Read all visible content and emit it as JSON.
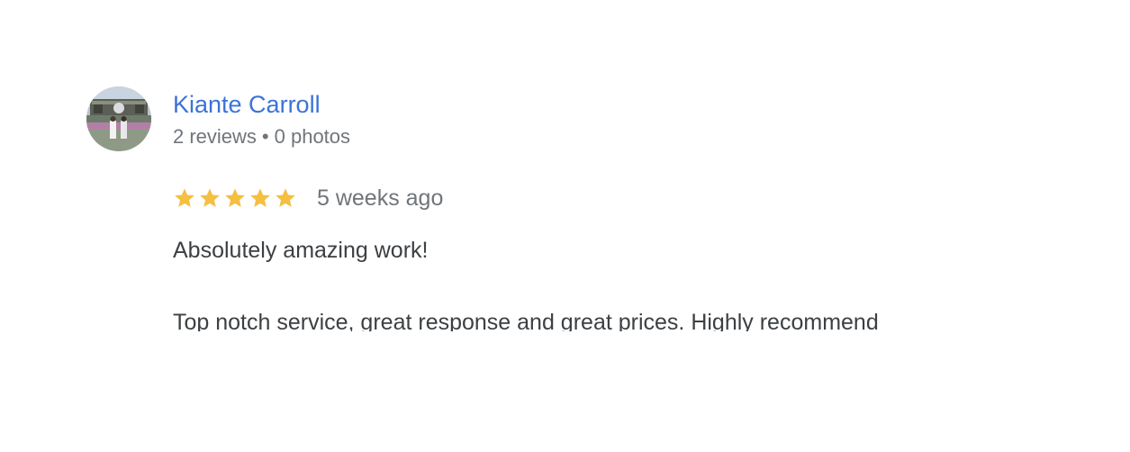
{
  "reviewer": {
    "name": "Kiante Carroll",
    "reviews_count": "2 reviews",
    "separator": "•",
    "photos_count": "0 photos"
  },
  "review": {
    "rating": 5,
    "max_rating": 5,
    "date": "5 weeks ago",
    "text_line_1": "Absolutely amazing work!",
    "text_line_2": "Top notch service, great response and great prices. Highly recommend"
  },
  "colors": {
    "name_link": "#3b73d8",
    "star": "#f4bf42",
    "meta": "#70757a",
    "body": "#3c4043"
  },
  "icons": {
    "avatar": "user-photo",
    "star": "star-filled-icon"
  }
}
